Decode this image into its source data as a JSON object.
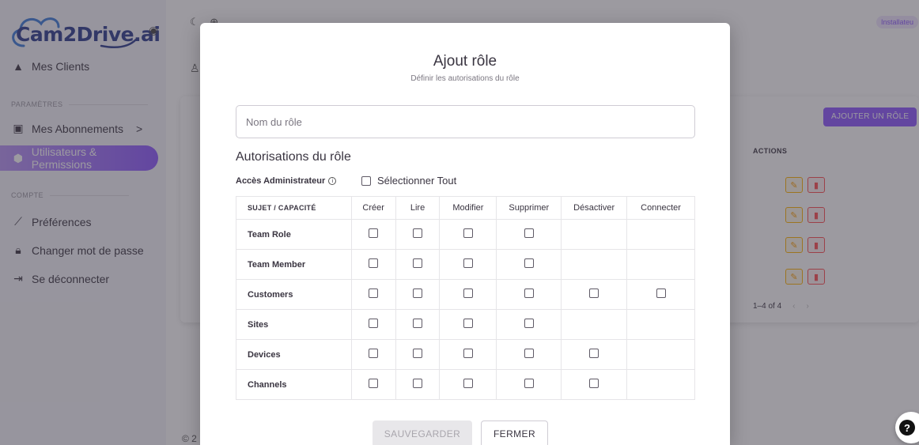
{
  "brand": {
    "name": "Cam2Drive.ai"
  },
  "sidebar": {
    "items": [
      {
        "label": "Mes Clients",
        "icon": "person-icon"
      },
      {
        "label": "Mes Abonnements",
        "icon": "wallet-icon",
        "chevron": ">"
      },
      {
        "label": "Utilisateurs & Permissions",
        "icon": "shield-icon"
      },
      {
        "label": "Préférences",
        "icon": "brush-icon"
      },
      {
        "label": "Changer mot de passe",
        "icon": "lock-icon"
      },
      {
        "label": "Se déconnecter",
        "icon": "logout-icon"
      }
    ],
    "sections": {
      "parametres": "PARAMÈTRES",
      "compte": "COMPTE"
    }
  },
  "background": {
    "badge": "Installateu",
    "add_role_button": "AJOUTER UN RÔLE",
    "actions_header": "ACTIONS",
    "pagination": "1–4 of 4",
    "footer_copy": "© 2"
  },
  "modal": {
    "title": "Ajout rôle",
    "subtitle": "Définir les autorisations du rôle",
    "role_name_placeholder": "Nom du rôle",
    "role_name_value": "",
    "permissions_heading": "Autorisations du rôle",
    "admin_access_label": "Accès Administrateur",
    "select_all_label": "Sélectionner Tout",
    "table": {
      "headers": [
        "SUJET / CAPACITÉ",
        "Créer",
        "Lire",
        "Modifier",
        "Supprimer",
        "Désactiver",
        "Connecter"
      ],
      "rows": [
        {
          "subject": "Team Role",
          "caps": [
            true,
            true,
            true,
            true,
            false,
            false
          ]
        },
        {
          "subject": "Team Member",
          "caps": [
            true,
            true,
            true,
            true,
            false,
            false
          ]
        },
        {
          "subject": "Customers",
          "caps": [
            true,
            true,
            true,
            true,
            true,
            true
          ]
        },
        {
          "subject": "Sites",
          "caps": [
            true,
            true,
            true,
            true,
            false,
            false
          ]
        },
        {
          "subject": "Devices",
          "caps": [
            true,
            true,
            true,
            true,
            true,
            false
          ]
        },
        {
          "subject": "Channels",
          "caps": [
            true,
            true,
            true,
            true,
            true,
            false
          ]
        }
      ]
    },
    "save_button": "SAUVEGARDER",
    "close_button": "FERMER"
  },
  "colors": {
    "primary": "#8c57ff",
    "warning": "#ffb400",
    "error": "#ff4c51"
  }
}
